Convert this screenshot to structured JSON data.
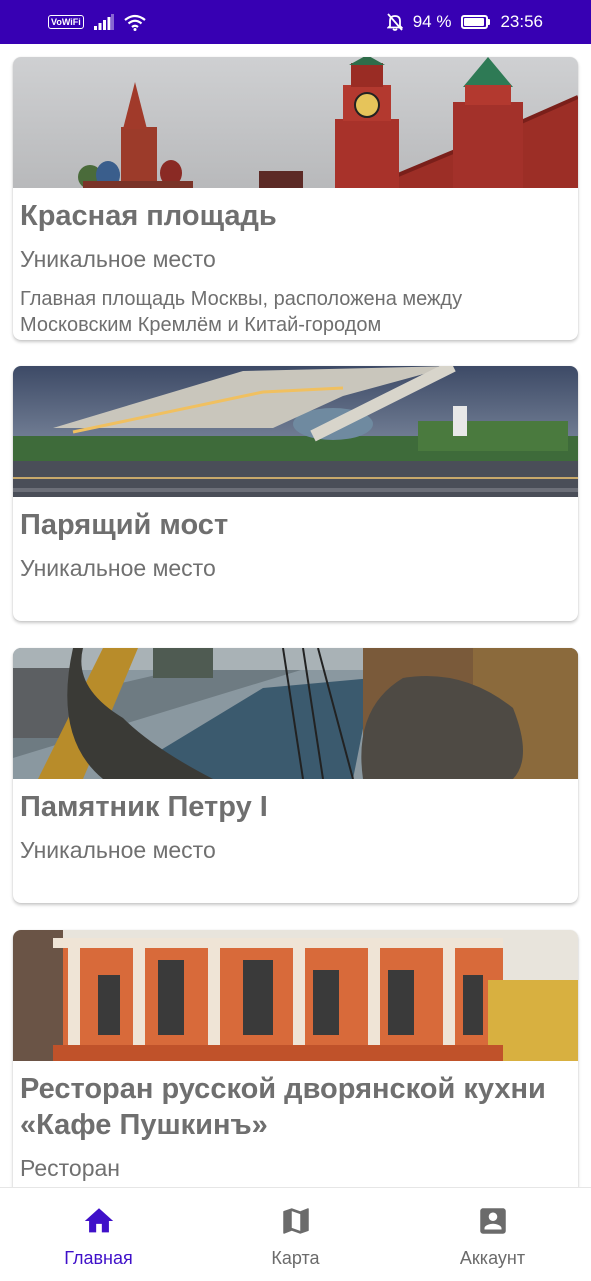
{
  "status_bar": {
    "vowifi": "VoWiFi",
    "battery_percent": "94 %",
    "battery_level": 0.94,
    "time": "23:56"
  },
  "places": [
    {
      "title": "Красная площадь",
      "category": "Уникальное место",
      "description": "Главная площадь Москвы, расположена между Московским Кремлём и Китай-городом"
    },
    {
      "title": "Парящий мост",
      "category": "Уникальное место",
      "description": ""
    },
    {
      "title": "Памятник Петру I",
      "category": "Уникальное место",
      "description": ""
    },
    {
      "title": "Ресторан русской дворянской кухни «Кафе Пушкинъ»",
      "category": "Ресторан",
      "description": ""
    }
  ],
  "bottom_nav": [
    {
      "label": "Главная",
      "icon": "home-icon",
      "active": true
    },
    {
      "label": "Карта",
      "icon": "map-icon",
      "active": false
    },
    {
      "label": "Аккаунт",
      "icon": "account-icon",
      "active": false
    }
  ],
  "colors": {
    "status_bar": "#3700b3",
    "nav_active": "#3f10c9",
    "nav_inactive": "#6b6b6b"
  }
}
